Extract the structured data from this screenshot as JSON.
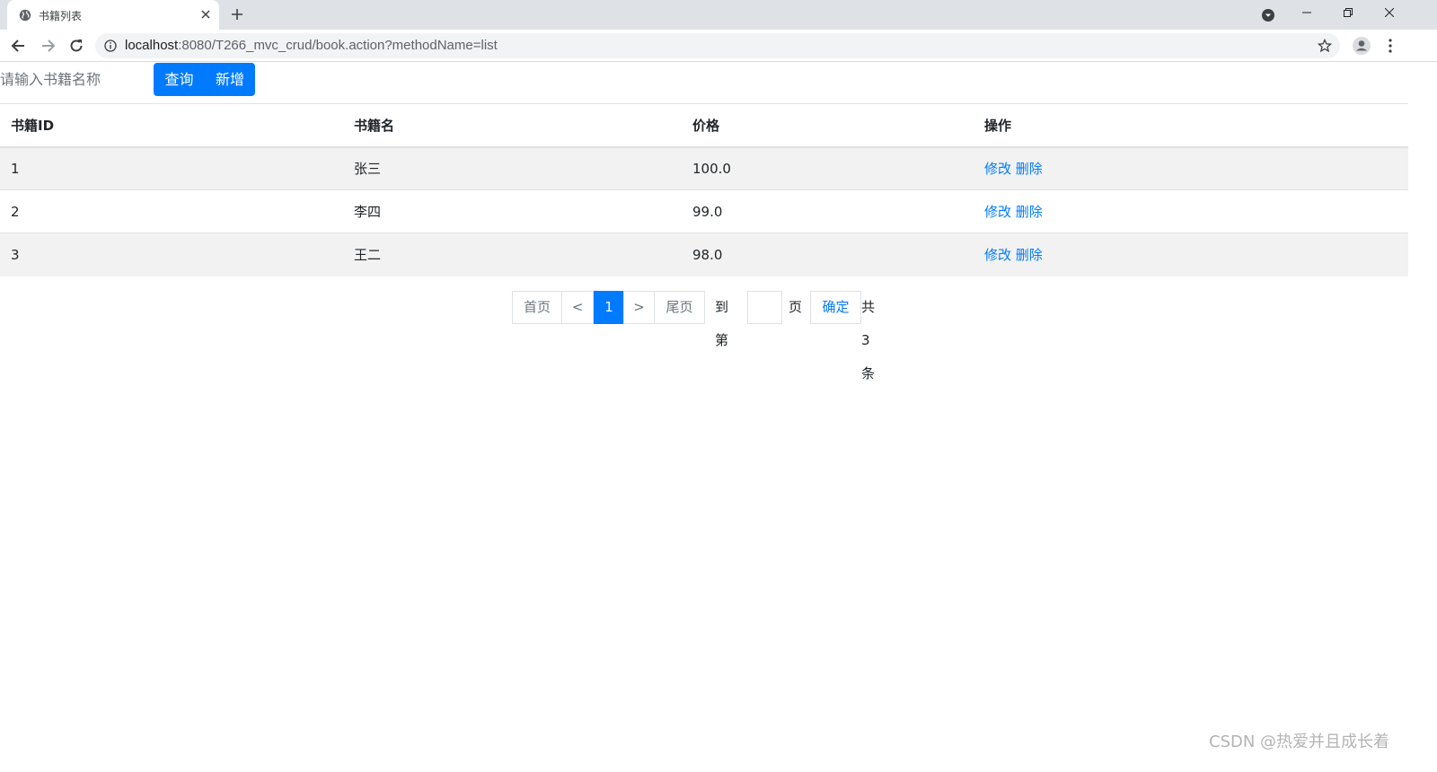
{
  "browser": {
    "tab_title": "书籍列表",
    "url_host": "localhost",
    "url_path": ":8080/T266_mvc_crud/book.action?methodName=list"
  },
  "search": {
    "placeholder": "请输入书籍名称",
    "value": "",
    "search_label": "查询",
    "add_label": "新增"
  },
  "table": {
    "headers": [
      "书籍ID",
      "书籍名",
      "价格",
      "操作"
    ],
    "rows": [
      {
        "id": "1",
        "name": "张三",
        "price": "100.0",
        "edit": "修改",
        "delete": "删除"
      },
      {
        "id": "2",
        "name": "李四",
        "price": "99.0",
        "edit": "修改",
        "delete": "删除"
      },
      {
        "id": "3",
        "name": "王二",
        "price": "98.0",
        "edit": "修改",
        "delete": "删除"
      }
    ]
  },
  "pagination": {
    "first": "首页",
    "prev": "<",
    "current": "1",
    "next": ">",
    "last": "尾页",
    "goto_prefix": "到第",
    "goto_suffix": "页",
    "confirm": "确定",
    "total": "共3条"
  },
  "watermark": "CSDN @热爱并且成长着",
  "colors": {
    "primary": "#007bff",
    "row_stripe": "#f2f2f2",
    "border": "#dee2e6"
  }
}
